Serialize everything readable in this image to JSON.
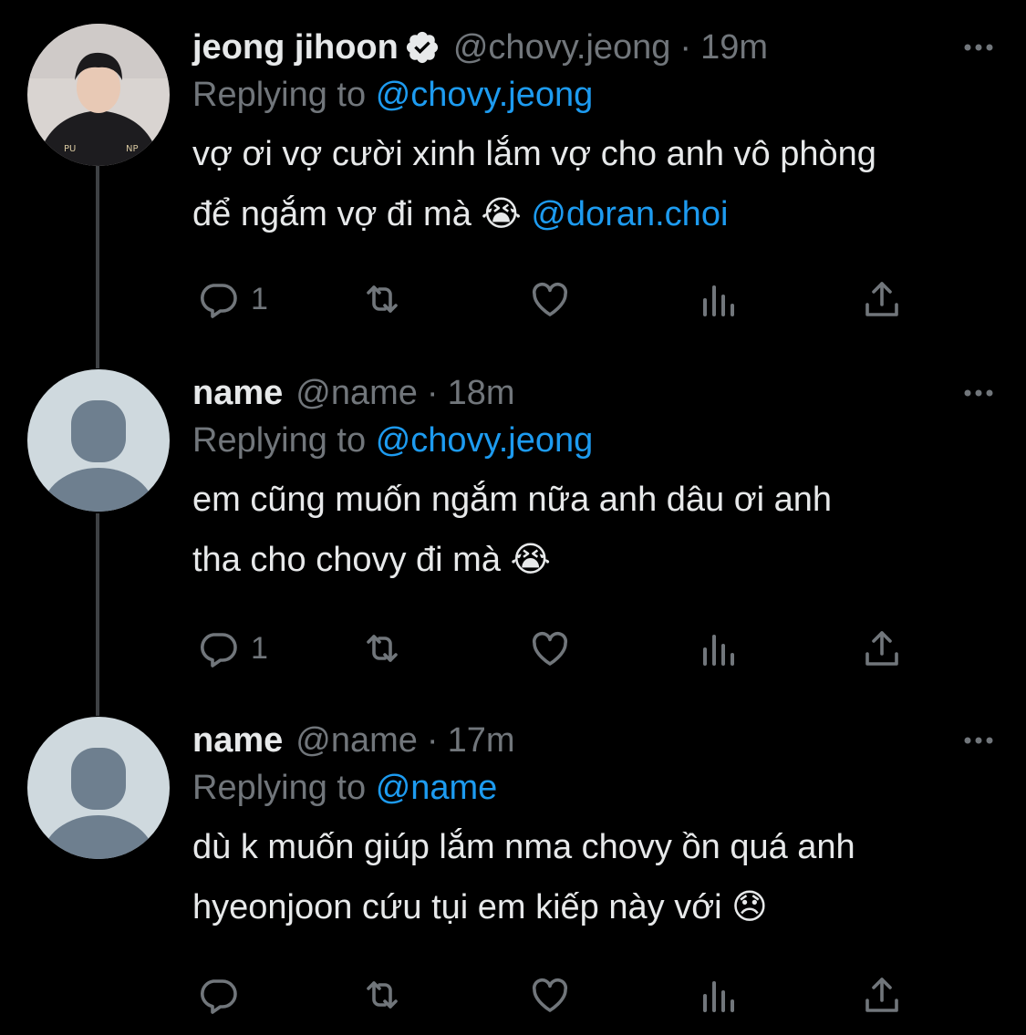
{
  "tweets": [
    {
      "display_name": "jeong jihoon",
      "handle": "@chovy.jeong",
      "time": "19m",
      "replying_prefix": "Replying to",
      "replying_to": "@chovy.jeong",
      "text": "vợ ơi vợ cười xinh lắm vợ cho anh vô phòng\nđể ngắm vợ đi mà 😭 ",
      "text_mention": "@doran.choi",
      "reply_count": "1",
      "avatar": "profile-photo",
      "verified": true
    },
    {
      "display_name": "name",
      "handle": "@name",
      "time": "18m",
      "replying_prefix": "Replying to",
      "replying_to": "@chovy.jeong",
      "text": "em cũng muốn ngắm nữa anh dâu ơi anh\ntha cho chovy đi mà 😭",
      "text_mention": "",
      "reply_count": "1",
      "avatar": "default-avatar"
    },
    {
      "display_name": "name",
      "handle": "@name",
      "time": "17m",
      "replying_prefix": "Replying to",
      "replying_to": "@name",
      "text": "dù k muốn giúp lắm nma chovy ồn quá anh\nhyeonjoon cứu tụi em kiếp này với 😞",
      "text_mention": "",
      "reply_count": "",
      "avatar": "default-avatar"
    }
  ],
  "separator": "·",
  "icons": [
    "reply-icon",
    "retweet-icon",
    "like-icon",
    "analytics-icon",
    "share-icon",
    "more-icon",
    "verified-icon"
  ],
  "colors": {
    "background": "#000000",
    "text": "#e7e9ea",
    "secondary": "#71767b",
    "accent": "#1d9bf0",
    "thread_line": "#3e4144",
    "default_avatar_bg": "#cfd9de",
    "default_avatar_fg": "#6e7f8f"
  }
}
